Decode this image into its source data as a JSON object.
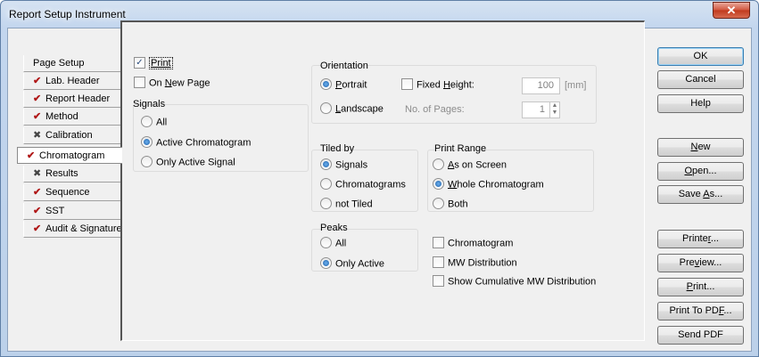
{
  "window": {
    "title": "Report Setup Instrument",
    "close_glyph": "✕"
  },
  "tabs": [
    {
      "label": "Page Setup",
      "icon": "none",
      "active": false
    },
    {
      "label": "Lab. Header",
      "icon": "check-icon",
      "active": false
    },
    {
      "label": "Report Header",
      "icon": "check-icon",
      "active": false
    },
    {
      "label": "Method",
      "icon": "check-icon",
      "active": false
    },
    {
      "label": "Calibration",
      "icon": "x-icon",
      "active": false
    },
    {
      "label": "Chromatogram",
      "icon": "check-icon",
      "active": true
    },
    {
      "label": "Results",
      "icon": "x-icon",
      "active": false
    },
    {
      "label": "Sequence",
      "icon": "check-icon",
      "active": false
    },
    {
      "label": "SST",
      "icon": "check-icon",
      "active": false
    },
    {
      "label": "Audit & Signatures",
      "icon": "check-icon",
      "active": false
    }
  ],
  "panel": {
    "print": {
      "label": "Print",
      "checked": true
    },
    "on_new_page": {
      "label_pre": "On ",
      "label_ul": "N",
      "label_post": "ew Page",
      "checked": false
    },
    "signals": {
      "title": "Signals",
      "options": [
        "All",
        "Active Chromatogram",
        "Only Active Signal"
      ],
      "selected": 1
    },
    "orientation": {
      "title": "Orientation",
      "portrait": {
        "ul": "P",
        "rest": "ortrait",
        "selected": true
      },
      "landscape": {
        "ul": "L",
        "rest": "andscape",
        "selected": false
      },
      "fixed_height": {
        "pre": "Fixed ",
        "ul": "H",
        "post": "eight:",
        "checked": false
      },
      "height_value": "100",
      "height_unit": "[mm]",
      "pages_label": "No. of Pages:",
      "pages_value": "1"
    },
    "tiled_by": {
      "title": "Tiled by",
      "options": [
        "Signals",
        "Chromatograms",
        "not Tiled"
      ],
      "selected": 0
    },
    "print_range": {
      "title": "Print Range",
      "options": [
        {
          "ul": "A",
          "rest": "s on Screen"
        },
        {
          "ul": "W",
          "rest": "hole Chromatogram"
        },
        {
          "ul": "",
          "rest": "Both"
        }
      ],
      "selected": 1
    },
    "peaks": {
      "title": "Peaks",
      "options": [
        "All",
        "Only Active"
      ],
      "selected": 1
    },
    "extras": [
      {
        "label": "Chromatogram",
        "checked": false
      },
      {
        "label": "MW Distribution",
        "checked": false
      },
      {
        "label": "Show Cumulative MW Distribution",
        "checked": false
      }
    ]
  },
  "buttons": {
    "ok": "OK",
    "cancel": "Cancel",
    "help": "Help",
    "new": {
      "ul": "N",
      "rest": "ew"
    },
    "open": {
      "ul": "O",
      "rest": "pen..."
    },
    "save_as": {
      "pre": "Save ",
      "ul": "A",
      "post": "s..."
    },
    "printer": {
      "pre": "Printe",
      "ul": "r",
      "post": "..."
    },
    "preview": {
      "pre": "Pre",
      "ul": "v",
      "post": "iew..."
    },
    "print": {
      "ul": "P",
      "rest": "rint..."
    },
    "print_to_pdf": {
      "pre": "Print To PD",
      "ul": "F",
      "post": "..."
    },
    "send_pdf": "Send PDF"
  }
}
